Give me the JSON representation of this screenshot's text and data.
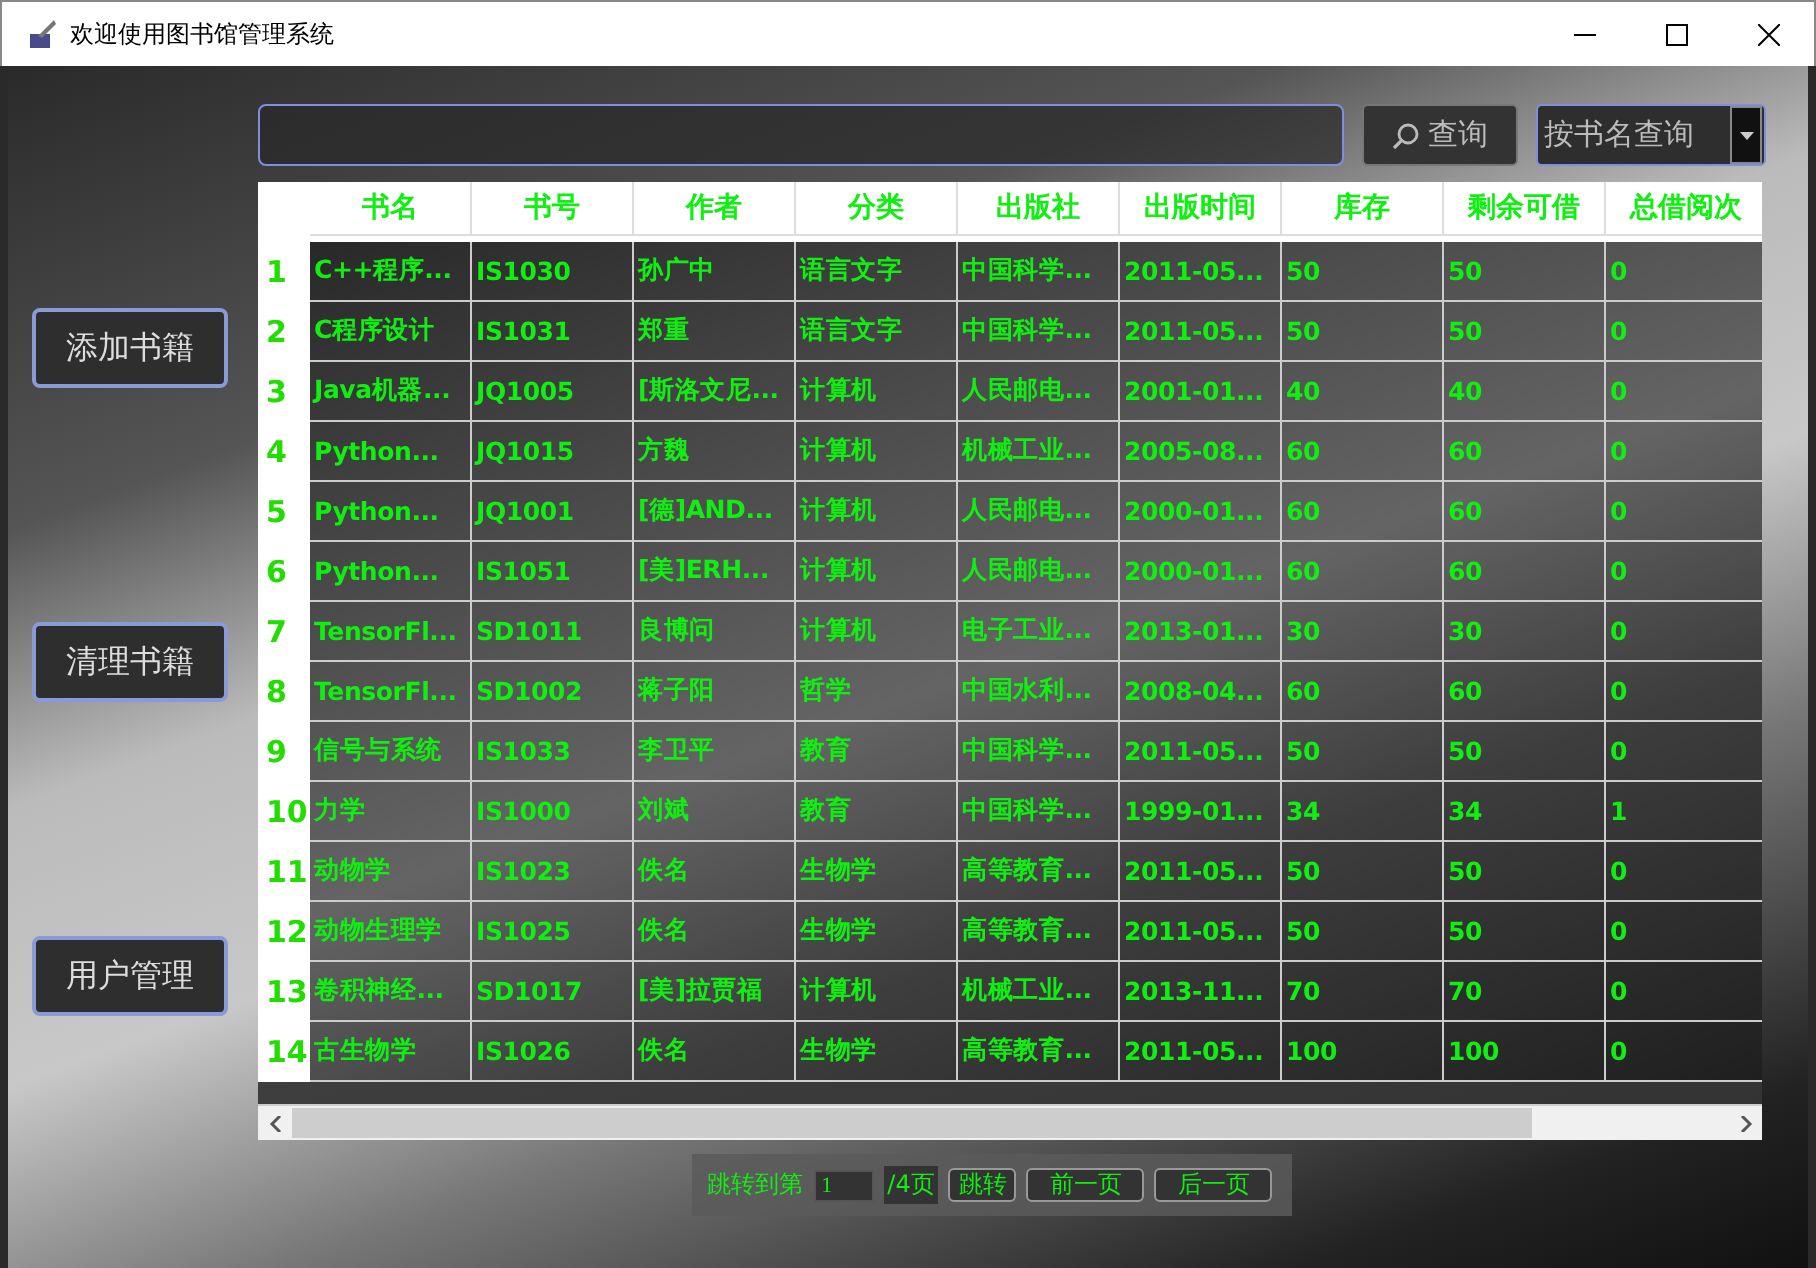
{
  "window": {
    "title": "欢迎使用图书馆管理系统"
  },
  "sidebar": {
    "buttons": [
      "添加书籍",
      "清理书籍",
      "用户管理"
    ]
  },
  "search": {
    "button": "查询",
    "mode": "按书名查询"
  },
  "table": {
    "columns": [
      "书名",
      "书号",
      "作者",
      "分类",
      "出版社",
      "出版时间",
      "库存",
      "剩余可借",
      "总借阅次"
    ],
    "rows": [
      {
        "number": "1",
        "cells": [
          "C++程序...",
          "IS1030",
          "孙广中",
          "语言文字",
          "中国科学...",
          "2011-05...",
          "50",
          "50",
          "0"
        ]
      },
      {
        "number": "2",
        "cells": [
          "C程序设计",
          "IS1031",
          "郑重",
          "语言文字",
          "中国科学...",
          "2011-05...",
          "50",
          "50",
          "0"
        ]
      },
      {
        "number": "3",
        "cells": [
          "Java机器...",
          "JQ1005",
          "[斯洛文尼...",
          "计算机",
          "人民邮电...",
          "2001-01...",
          "40",
          "40",
          "0"
        ]
      },
      {
        "number": "4",
        "cells": [
          "Python...",
          "JQ1015",
          "方魏",
          "计算机",
          "机械工业...",
          "2005-08...",
          "60",
          "60",
          "0"
        ]
      },
      {
        "number": "5",
        "cells": [
          "Python...",
          "JQ1001",
          "[德]AND...",
          "计算机",
          "人民邮电...",
          "2000-01...",
          "60",
          "60",
          "0"
        ]
      },
      {
        "number": "6",
        "cells": [
          "Python...",
          "IS1051",
          "[美]ERH...",
          "计算机",
          "人民邮电...",
          "2000-01...",
          "60",
          "60",
          "0"
        ]
      },
      {
        "number": "7",
        "cells": [
          "TensorFl...",
          "SD1011",
          "良博问",
          "计算机",
          "电子工业...",
          "2013-01...",
          "30",
          "30",
          "0"
        ]
      },
      {
        "number": "8",
        "cells": [
          "TensorFl...",
          "SD1002",
          "蒋子阳",
          "哲学",
          "中国水利...",
          "2008-04...",
          "60",
          "60",
          "0"
        ]
      },
      {
        "number": "9",
        "cells": [
          "信号与系统",
          "IS1033",
          "李卫平",
          "教育",
          "中国科学...",
          "2011-05...",
          "50",
          "50",
          "0"
        ]
      },
      {
        "number": "10",
        "cells": [
          "力学",
          "IS1000",
          "刘斌",
          "教育",
          "中国科学...",
          "1999-01...",
          "34",
          "34",
          "1"
        ]
      },
      {
        "number": "11",
        "cells": [
          "动物学",
          "IS1023",
          "佚名",
          "生物学",
          "高等教育...",
          "2011-05...",
          "50",
          "50",
          "0"
        ]
      },
      {
        "number": "12",
        "cells": [
          "动物生理学",
          "IS1025",
          "佚名",
          "生物学",
          "高等教育...",
          "2011-05...",
          "50",
          "50",
          "0"
        ]
      },
      {
        "number": "13",
        "cells": [
          "卷积神经...",
          "SD1017",
          "[美]拉贾福",
          "计算机",
          "机械工业...",
          "2013-11...",
          "70",
          "70",
          "0"
        ]
      },
      {
        "number": "14",
        "cells": [
          "古生物学",
          "IS1026",
          "佚名",
          "生物学",
          "高等教育...",
          "2011-05...",
          "100",
          "100",
          "0"
        ]
      }
    ]
  },
  "pager": {
    "label": "跳转到第",
    "page": "1",
    "total": "/4页",
    "jump": "跳转",
    "prev": "前一页",
    "next": "后一页"
  }
}
